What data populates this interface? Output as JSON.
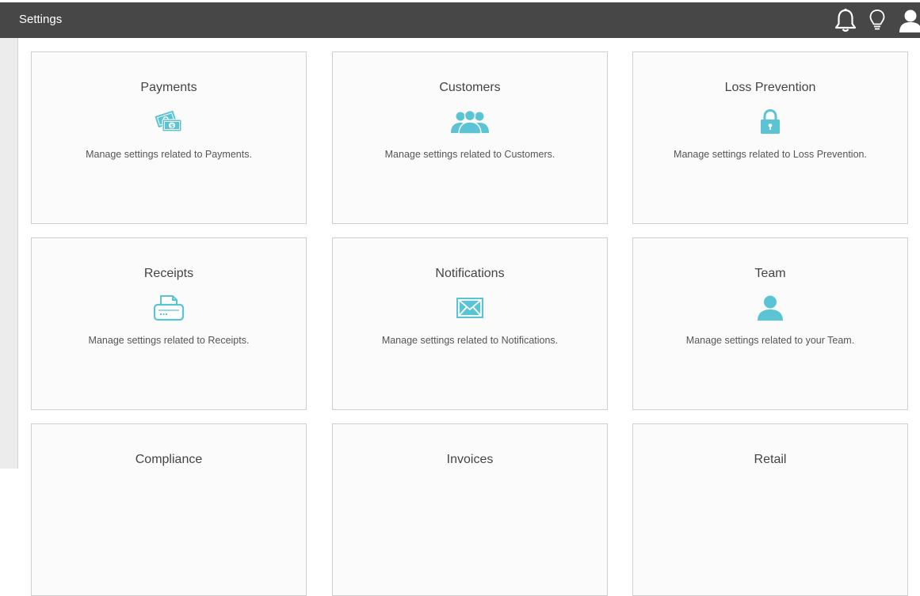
{
  "header": {
    "title": "Settings",
    "icons": [
      "bell-icon",
      "lightbulb-icon",
      "user-icon"
    ]
  },
  "accent_color": "#5bc4d4",
  "tiles": [
    {
      "title": "Payments",
      "description": "Manage settings related to Payments.",
      "icon": "money-icon"
    },
    {
      "title": "Customers",
      "description": "Manage settings related to Customers.",
      "icon": "customers-icon"
    },
    {
      "title": "Loss Prevention",
      "description": "Manage settings related to Loss Prevention.",
      "icon": "lock-icon"
    },
    {
      "title": "Receipts",
      "description": "Manage settings related to Receipts.",
      "icon": "printer-icon"
    },
    {
      "title": "Notifications",
      "description": "Manage settings related to Notifications.",
      "icon": "envelope-icon"
    },
    {
      "title": "Team",
      "description": "Manage settings related to your Team.",
      "icon": "person-icon"
    },
    {
      "title": "Compliance",
      "description": "",
      "icon": ""
    },
    {
      "title": "Invoices",
      "description": "",
      "icon": ""
    },
    {
      "title": "Retail",
      "description": "",
      "icon": ""
    }
  ]
}
